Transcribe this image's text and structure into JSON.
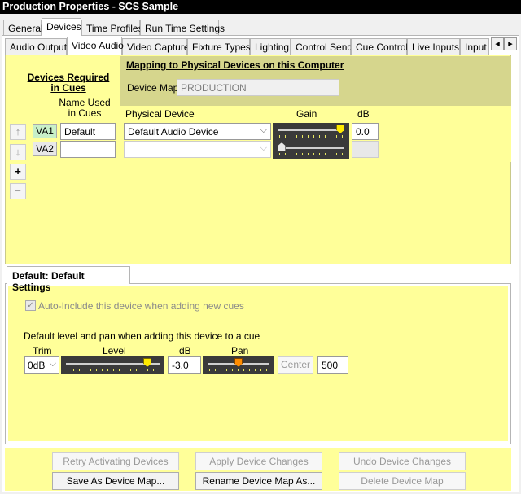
{
  "window": {
    "title": "Production Properties - SCS Sample"
  },
  "top_tabs": [
    {
      "label": "General"
    },
    {
      "label": "Devices"
    },
    {
      "label": "Time Profiles"
    },
    {
      "label": "Run Time Settings"
    }
  ],
  "device_tabs": [
    {
      "label": "Audio Output"
    },
    {
      "label": "Video Audio"
    },
    {
      "label": "Video Capture"
    },
    {
      "label": "Fixture Types"
    },
    {
      "label": "Lighting"
    },
    {
      "label": "Control Send"
    },
    {
      "label": "Cue Control"
    },
    {
      "label": "Live Inputs"
    },
    {
      "label": "Input G"
    }
  ],
  "left_panel": {
    "heading_line1": "Devices Required",
    "heading_line2": "in Cues",
    "name_col_line1": "Name Used",
    "name_col_line2": "in Cues",
    "devices": [
      {
        "id": "VA1",
        "name": "Default"
      },
      {
        "id": "VA2",
        "name": ""
      }
    ],
    "up_icon": "↑",
    "down_icon": "↓",
    "add_icon": "+",
    "remove_icon": "−"
  },
  "mapping": {
    "title": "Mapping to Physical Devices on this Computer",
    "device_map_label": "Device Map",
    "device_map_value": "PRODUCTION",
    "col_physical": "Physical Device",
    "col_gain": "Gain",
    "col_db": "dB",
    "rows": [
      {
        "physical_device": "Default Audio Device",
        "gain_level": 1.0,
        "db": "0.0"
      },
      {
        "physical_device": "",
        "gain_level": 0.0,
        "db": ""
      }
    ]
  },
  "defaults": {
    "tab_label": "Default: Default Settings",
    "auto_include_label": "Auto-Include this device when adding new cues",
    "auto_include_checked": true,
    "level_pan_label": "Default level and pan when adding this device to a cue",
    "trim_label": "Trim",
    "level_label": "Level",
    "db_label": "dB",
    "pan_label": "Pan",
    "trim_value": "0dB",
    "level_fraction": 0.9,
    "db_value": "-3.0",
    "pan_fraction": 0.5,
    "center_label": "Center",
    "pan_value": "500"
  },
  "buttons": {
    "retry": "Retry Activating Devices",
    "apply": "Apply Device Changes",
    "undo": "Undo Device Changes",
    "save_map": "Save As Device Map...",
    "rename_map": "Rename Device Map As...",
    "delete_map": "Delete Device Map"
  },
  "icons": {
    "chevron_down": "⌵",
    "scroll_left": "◂",
    "scroll_right": "▸",
    "check": "✓"
  }
}
